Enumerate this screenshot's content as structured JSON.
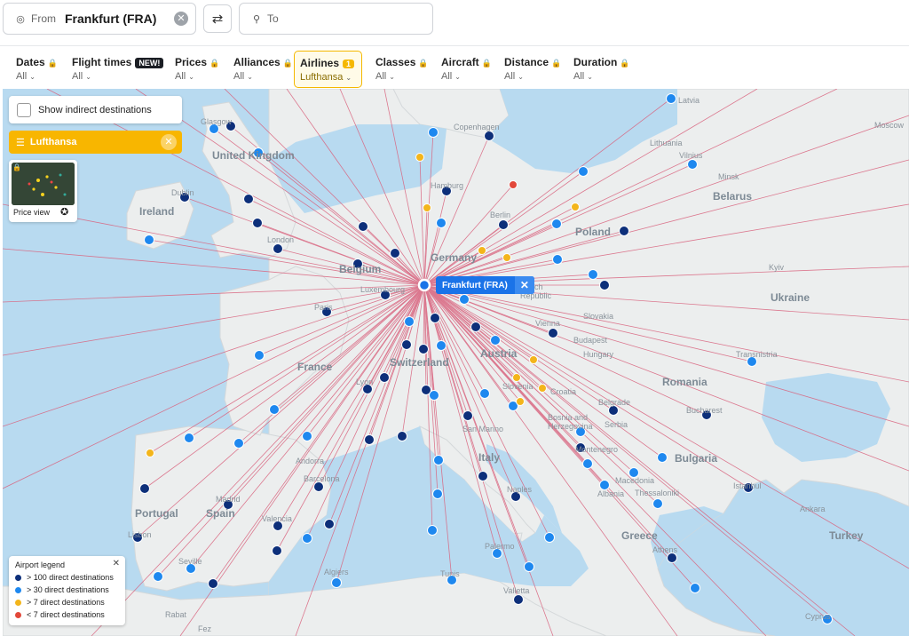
{
  "search": {
    "from_label": "From",
    "from_value": "Frankfurt (FRA)",
    "to_placeholder": "To"
  },
  "filters": [
    {
      "name": "Dates",
      "value": "All",
      "locked": true
    },
    {
      "name": "Flight times",
      "value": "All",
      "badge": "NEW!"
    },
    {
      "name": "Prices",
      "value": "All",
      "locked": true
    },
    {
      "name": "Alliances",
      "value": "All",
      "locked": true
    },
    {
      "name": "Airlines",
      "value": "Lufthansa",
      "count": "1",
      "active": true
    },
    {
      "name": "Classes",
      "value": "All",
      "locked": true
    },
    {
      "name": "Aircraft",
      "value": "All",
      "locked": true
    },
    {
      "name": "Distance",
      "value": "All",
      "locked": true
    },
    {
      "name": "Duration",
      "value": "All",
      "locked": true
    }
  ],
  "map": {
    "indirect_label": "Show indirect destinations",
    "airline_chip": "Lufthansa",
    "price_view_label": "Price view",
    "origin_label": "Frankfurt (FRA)",
    "country_labels": [
      "United Kingdom",
      "Ireland",
      "Belgium",
      "Germany",
      "Poland",
      "Belarus",
      "Ukraine",
      "France",
      "Switzerland",
      "Austria",
      "Hungary",
      "Romania",
      "Croatia",
      "Bosnia and Herzegovina",
      "Serbia",
      "Bulgaria",
      "Italy",
      "Portugal",
      "Spain",
      "Greece",
      "Turkey",
      "Slovakia",
      "Czech Republic",
      "Slovenia",
      "San Marino",
      "Montenegro",
      "Albania",
      "Macedonia",
      "Latvia",
      "Lithuania",
      "Andorra"
    ],
    "city_labels": [
      "Glasgow",
      "Dublin",
      "London",
      "Copenhagen",
      "Hamburg",
      "Berlin",
      "Vilnius",
      "Minsk",
      "Kyiv",
      "Moscow",
      "Luxembourg",
      "Paris",
      "Vienna",
      "Budapest",
      "Lyon",
      "Belgrade",
      "Bucharest",
      "Transnistria",
      "Rome",
      "Naples",
      "Palermo",
      "Valletta",
      "Tunis",
      "Algiers",
      "Madrid",
      "Lisbon",
      "Seville",
      "Barcelona",
      "Valencia",
      "Istanbul",
      "Ankara",
      "Athens",
      "Thessaloniki",
      "Rabat",
      "Fez",
      "Cyprus",
      "Riga"
    ]
  },
  "legend": {
    "title": "Airport legend",
    "items": [
      {
        "label": "> 100 direct destinations",
        "color": "#0d2f7a"
      },
      {
        "label": "> 30 direct destinations",
        "color": "#1e88ef"
      },
      {
        "label": "> 7 direct destinations",
        "color": "#f3b51b"
      },
      {
        "label": "< 7 direct destinations",
        "color": "#e2483a"
      }
    ]
  },
  "colors": {
    "route": "#d9647f",
    "land": "#eceeee",
    "sea": "#b8daf0",
    "accent": "#f5b800",
    "origin": "#1a73e8"
  }
}
